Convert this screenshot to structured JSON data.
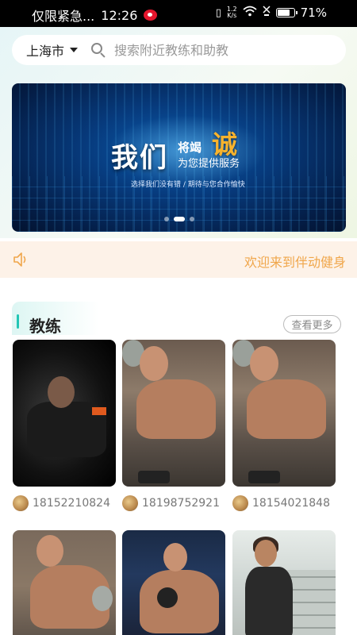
{
  "status_bar": {
    "notification_text": "仅限紧急...",
    "time": "12:26",
    "network_speed_value": "1.2",
    "network_speed_unit": "K/s",
    "battery": "71%"
  },
  "header": {
    "city": "上海市",
    "search_placeholder": "搜索附近教练和助教"
  },
  "banner": {
    "headline_big": "我们",
    "headline_mid": "将竭",
    "headline_accent": "诚",
    "headline_sub": "为您提供服务",
    "tagline": "选择我们没有错 / 期待与您合作愉快",
    "slide_count": 3,
    "active_slide": 2
  },
  "notice": {
    "text": "欢迎来到伴动健身"
  },
  "coach_section": {
    "title": "教练",
    "more_label": "查看更多",
    "coaches": [
      {
        "phone": "18152210824"
      },
      {
        "phone": "18198752921"
      },
      {
        "phone": "18154021848"
      },
      {
        "phone": ""
      },
      {
        "phone": ""
      },
      {
        "phone": ""
      }
    ]
  },
  "colors": {
    "accent_teal": "#23c6b5",
    "notice_text": "#f0a64a",
    "notice_bg": "#fdf2e8",
    "banner_accent": "#f7b32d"
  }
}
